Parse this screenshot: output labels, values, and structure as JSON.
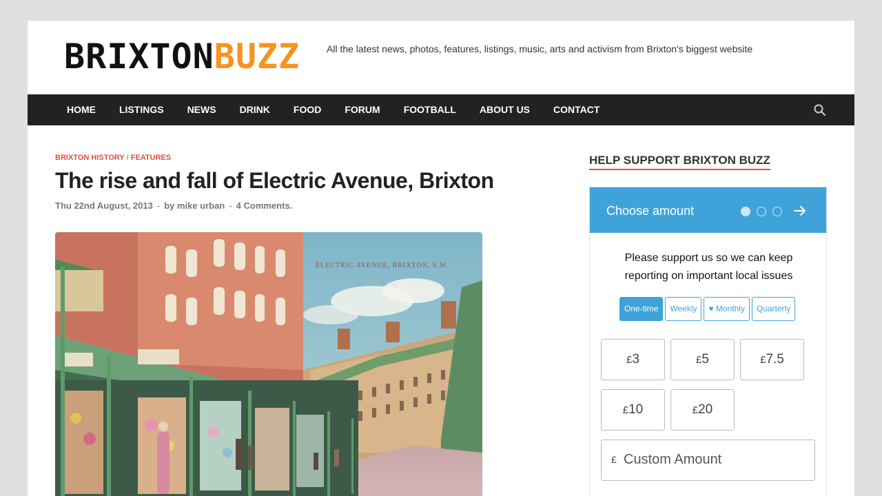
{
  "header": {
    "logo_part1": "BRIXTON",
    "logo_part2": "BUZZ",
    "tagline": "All the latest news, photos, features, listings, music, arts and activism from Brixton's biggest website"
  },
  "nav": {
    "items": [
      "HOME",
      "LISTINGS",
      "NEWS",
      "DRINK",
      "FOOD",
      "FORUM",
      "FOOTBALL",
      "ABOUT US",
      "CONTACT"
    ],
    "search_icon": "search-icon"
  },
  "article": {
    "category1": "BRIXTON HISTORY",
    "category_sep": "/",
    "category2": "FEATURES",
    "title": "The rise and fall of Electric Avenue, Brixton",
    "date": "Thu 22nd August, 2013",
    "author": "by mike urban",
    "comments": "4 Comments.",
    "image_caption_text": "ELECTRIC AVENUE, BRIXTON, S.W."
  },
  "sidebar": {
    "heading": "HELP SUPPORT BRIXTON BUZZ",
    "widget": {
      "title": "Choose amount",
      "prompt_line1": "Please support us so we can keep",
      "prompt_line2": "reporting on important local issues",
      "frequencies": [
        "One-time",
        "Weekly",
        "Monthly",
        "Quarterly"
      ],
      "selected_frequency": "One-time",
      "currency": "£",
      "amounts": [
        "3",
        "5",
        "7.5",
        "10",
        "20"
      ],
      "custom_placeholder": "Custom Amount",
      "accent_color": "#3fa3d9"
    }
  },
  "colors": {
    "brand_orange": "#f7931e",
    "category_red": "#e74c3c",
    "nav_bg": "#222222"
  }
}
